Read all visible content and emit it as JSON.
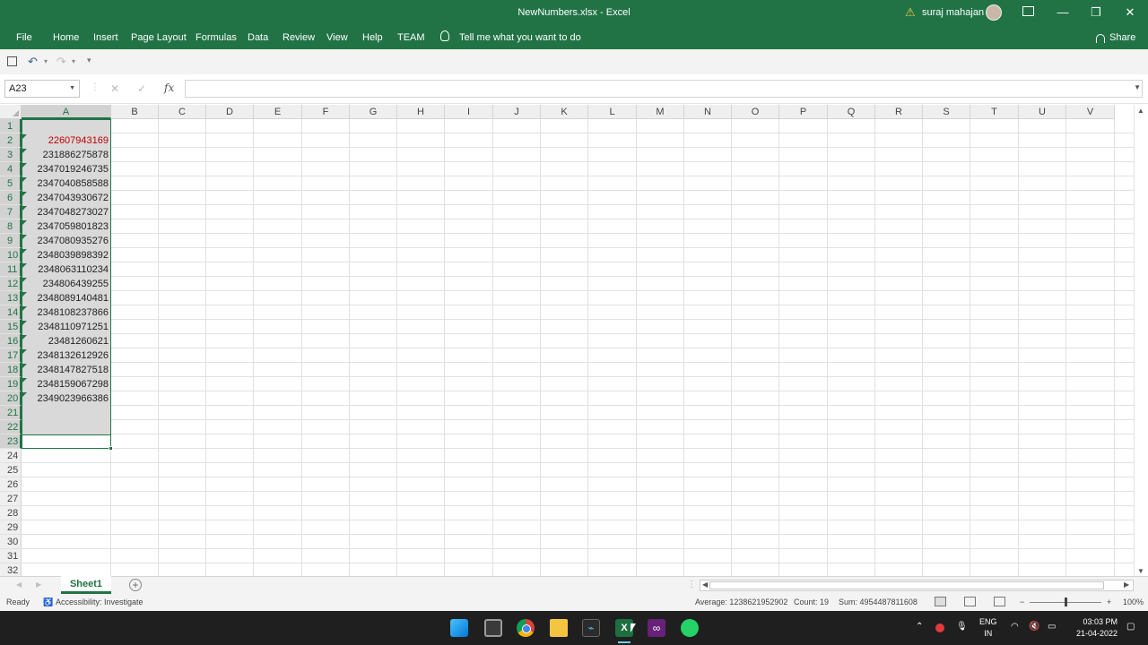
{
  "window": {
    "title": "NewNumbers.xlsx  -  Excel",
    "user": "suraj mahajan"
  },
  "menu": [
    "File",
    "Home",
    "Insert",
    "Page Layout",
    "Formulas",
    "Data",
    "Review",
    "View",
    "Help",
    "TEAM"
  ],
  "tell_me": "Tell me what you want to do",
  "share": "Share",
  "formula_bar": {
    "name_box": "A23",
    "fx": "fx",
    "formula": ""
  },
  "columns": [
    "A",
    "B",
    "C",
    "D",
    "E",
    "F",
    "G",
    "H",
    "I",
    "J",
    "K",
    "L",
    "M",
    "N",
    "O",
    "P",
    "Q",
    "R",
    "S",
    "T",
    "U",
    "V"
  ],
  "rows": [
    "1",
    "2",
    "3",
    "4",
    "5",
    "6",
    "7",
    "8",
    "9",
    "10",
    "11",
    "12",
    "13",
    "14",
    "15",
    "16",
    "17",
    "18",
    "19",
    "20",
    "21",
    "22",
    "23",
    "24",
    "25",
    "26",
    "27",
    "28",
    "29",
    "30",
    "31",
    "32"
  ],
  "cells_A": [
    {
      "row": 2,
      "value": "22607943169",
      "red": true
    },
    {
      "row": 3,
      "value": "231886275878"
    },
    {
      "row": 4,
      "value": "2347019246735"
    },
    {
      "row": 5,
      "value": "2347040858588"
    },
    {
      "row": 6,
      "value": "2347043930672"
    },
    {
      "row": 7,
      "value": "2347048273027"
    },
    {
      "row": 8,
      "value": "2347059801823"
    },
    {
      "row": 9,
      "value": "2347080935276"
    },
    {
      "row": 10,
      "value": "2348039898392"
    },
    {
      "row": 11,
      "value": "2348063110234"
    },
    {
      "row": 12,
      "value": "234806439255"
    },
    {
      "row": 13,
      "value": "2348089140481"
    },
    {
      "row": 14,
      "value": "2348108237866"
    },
    {
      "row": 15,
      "value": "2348110971251"
    },
    {
      "row": 16,
      "value": "23481260621"
    },
    {
      "row": 17,
      "value": "2348132612926"
    },
    {
      "row": 18,
      "value": "2348147827518"
    },
    {
      "row": 19,
      "value": "2348159067298"
    },
    {
      "row": 20,
      "value": "2349023966386"
    }
  ],
  "sheet_tab": "Sheet1",
  "status": {
    "ready": "Ready",
    "accessibility": "Accessibility: Investigate",
    "average": "Average: 1238621952902",
    "count": "Count: 19",
    "sum": "Sum: 4954487811608",
    "zoom": "100%"
  },
  "taskbar": {
    "lang_line1": "ENG",
    "lang_line2": "IN",
    "time": "03:03 PM",
    "date": "21-04-2022"
  },
  "colors": {
    "excel_green": "#217346",
    "error_red": "#c00000"
  }
}
